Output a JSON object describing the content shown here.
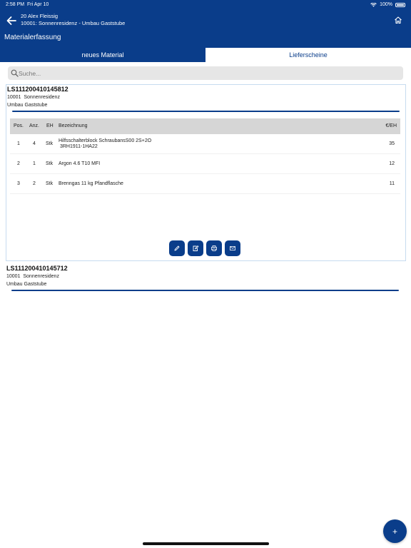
{
  "statusbar": {
    "time": "2:58 PM",
    "date": "Fri Apr 10",
    "battery": "100%"
  },
  "header": {
    "user": "20 Alex Fleissig",
    "project": "10001: Sonnenresidenz - Umbau Gaststube",
    "title": "Materialerfassung"
  },
  "tabs": {
    "new_material": "neues Material",
    "delivery_notes": "Lieferscheine"
  },
  "search": {
    "placeholder": "Suche..."
  },
  "notes": [
    {
      "number": "LS111200410145812",
      "project_no": "10001",
      "project_name": "Sonnenresidenz",
      "site": "Umbau Gaststube",
      "columns": {
        "pos": "Pos.",
        "qty": "Anz.",
        "unit": "EH",
        "desc": "Bezeichnung",
        "price": "€/EH"
      },
      "items": [
        {
          "pos": "1",
          "qty": "4",
          "unit": "Stk",
          "desc1": "Hilfsschalterblock SchraubansS00 2S+2O",
          "desc2": " 3RH1911-1HA22",
          "price": "35"
        },
        {
          "pos": "2",
          "qty": "1",
          "unit": "Stk",
          "desc1": "Argon 4.6 T10 MFI",
          "desc2": "",
          "price": "12"
        },
        {
          "pos": "3",
          "qty": "2",
          "unit": "Stk",
          "desc1": "Brenngas 11 kg Pfandflasche",
          "desc2": "",
          "price": "11"
        }
      ]
    },
    {
      "number": "LS111200410145712",
      "project_no": "10001",
      "project_name": "Sonnenresidenz",
      "site": "Umbau Gaststube"
    }
  ],
  "fab": {
    "label": "+"
  },
  "colors": {
    "primary": "#0a3d8a",
    "table_header": "#d6d6d6",
    "card_border": "#c7dbef"
  }
}
